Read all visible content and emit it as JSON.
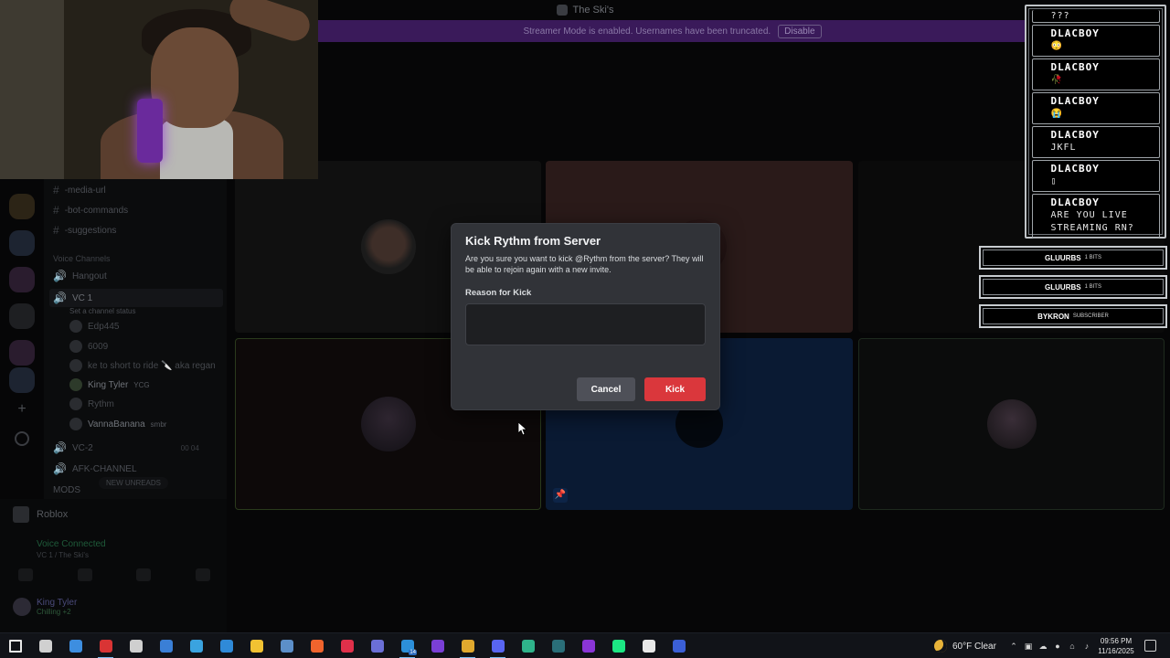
{
  "window": {
    "title": "The Ski's",
    "streamer_banner": "Streamer Mode is enabled. Usernames have been truncated.",
    "streamer_disable": "Disable"
  },
  "channels": {
    "text": [
      {
        "name": "-media-url"
      },
      {
        "name": "-bot-commands"
      },
      {
        "name": "-suggestions"
      }
    ],
    "voice_category": "Voice Channels",
    "hangout": "Hangout",
    "vc1": "VC 1",
    "vc1_status": "Set a channel status",
    "members": [
      {
        "name": "Edp445",
        "badge": ""
      },
      {
        "name": "6009",
        "badge": ""
      },
      {
        "name": "ke to short to ride 🔪 aka regan",
        "badge": ""
      },
      {
        "name": "King Tyler",
        "badge": "YCG"
      },
      {
        "name": "Rythm",
        "badge": ""
      },
      {
        "name": "VannaBanana",
        "badge": "smbr"
      }
    ],
    "vc2": "VC-2",
    "vc2_counts": "00  04",
    "afk": "AFK-CHANNEL",
    "mods": "MODS",
    "new_unreads": "NEW UNREADS"
  },
  "lower": {
    "game": "Roblox",
    "voice_connected": "Voice Connected",
    "voice_location": "VC 1 / The Ski's",
    "user_name": "King Tyler",
    "user_status": "Chilling +2"
  },
  "chat": {
    "partial_top": "???",
    "messages": [
      {
        "user": "DLACBOY",
        "text": "😳"
      },
      {
        "user": "DLACBOY",
        "text": "🥀"
      },
      {
        "user": "DLACBOY",
        "text": "😭"
      },
      {
        "user": "DLACBOY",
        "text": "JKFL"
      },
      {
        "user": "DLACBOY",
        "text": "▯"
      },
      {
        "user": "DLACBOY",
        "text": "ARE YOU LIVE STREAMING RN?"
      }
    ]
  },
  "alerts": [
    {
      "user": "GLUURBS",
      "kind": "1 BITS"
    },
    {
      "user": "GLUURBS",
      "kind": "1 BITS"
    },
    {
      "user": "BYKRON",
      "kind": "SUBSCRIBER"
    }
  ],
  "dialog": {
    "title": "Kick Rythm from Server",
    "description": "Are you sure you want to kick @Rythm from the server? They will be able to rejoin again with a new invite.",
    "reason_label": "Reason for Kick",
    "reason_value": "",
    "cancel": "Cancel",
    "kick": "Kick",
    "kick_color": "#da373c"
  },
  "taskbar": {
    "apps": [
      {
        "icon": "windows-start-icon",
        "color": "#e8e8e8"
      },
      {
        "icon": "task-view-icon",
        "color": "#d0d0d0"
      },
      {
        "icon": "widgets-icon",
        "color": "#3d8ee0"
      },
      {
        "icon": "roblox-studio-icon",
        "color": "#d93434"
      },
      {
        "icon": "settings-icon",
        "color": "#cfcfcf"
      },
      {
        "icon": "store-icon",
        "color": "#3a7fd6"
      },
      {
        "icon": "copilot-icon",
        "color": "#3aa3e0"
      },
      {
        "icon": "app-blue-icon",
        "color": "#2f8ad8"
      },
      {
        "icon": "file-explorer-icon",
        "color": "#f1c232"
      },
      {
        "icon": "steam-icon",
        "color": "#5c8fc9"
      },
      {
        "icon": "app-orange-icon",
        "color": "#f0642d"
      },
      {
        "icon": "app-red-icon",
        "color": "#e0304a"
      },
      {
        "icon": "app-purple-icon",
        "color": "#6b6fd6"
      },
      {
        "icon": "mail-icon",
        "color": "#2c8fd9",
        "count": "14"
      },
      {
        "icon": "app-violet-icon",
        "color": "#7a3fd6"
      },
      {
        "icon": "chrome-icon",
        "color": "#e0a82e"
      },
      {
        "icon": "discord-icon",
        "color": "#5865f2"
      },
      {
        "icon": "app-teal-icon",
        "color": "#2fb38a"
      },
      {
        "icon": "app-dark-icon",
        "color": "#2a6e78"
      },
      {
        "icon": "vivaldi-icon",
        "color": "#8a35d6"
      },
      {
        "icon": "hulu-icon",
        "color": "#1ce783"
      },
      {
        "icon": "capcut-icon",
        "color": "#e8e8e8"
      },
      {
        "icon": "app-blue2-icon",
        "color": "#3b5fd6"
      }
    ],
    "weather": "60°F  Clear",
    "time": "09:56 PM",
    "date": "11/16/2025"
  }
}
